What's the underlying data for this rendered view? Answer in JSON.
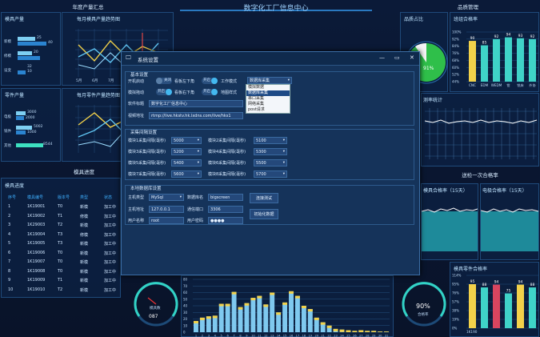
{
  "header": {
    "left_title": "年度产量汇总",
    "center_title": "数字化工厂信息中心",
    "right_title": "品质管理"
  },
  "panels": {
    "annual_output": "模具产量",
    "monthly_mold": "每月模具产量趋势图",
    "part_output": "零件产量",
    "monthly_part": "每月零件产量趋势图",
    "mold_progress": "模具进度",
    "quality_tab": "品质占比",
    "pass_rate": "班组合格率",
    "sample_stats": "测率统计",
    "first_pass": "送检一次合格率",
    "mold_rate": "模具合格率（15天）",
    "elec_rate": "电极合格率（15天）",
    "part_rate": "模具零件合格率"
  },
  "mold_bars": {
    "labels": [
      "新模",
      "修模",
      "设变"
    ],
    "values": [
      "25",
      "40",
      "20",
      "32",
      "10"
    ]
  },
  "part_bars": {
    "labels": [
      "电极",
      "铣件",
      "其他"
    ],
    "values": [
      "3000",
      "2000",
      "5002",
      "1000",
      "8544"
    ]
  },
  "trend_months": [
    "5月",
    "6月",
    "7月",
    "8月",
    "9月"
  ],
  "progress_table": {
    "headers": [
      "序号",
      "模具编号",
      "版本号",
      "类型",
      "状态"
    ],
    "rows": [
      [
        "1",
        "1K19001",
        "T0",
        "新模",
        "加工中"
      ],
      [
        "2",
        "1K19002",
        "T1",
        "修模",
        "加工中"
      ],
      [
        "3",
        "1K29003",
        "T2",
        "新模",
        "加工中"
      ],
      [
        "4",
        "1K19004",
        "T3",
        "修模",
        "加工中"
      ],
      [
        "5",
        "1K19005",
        "T3",
        "新模",
        "加工中"
      ],
      [
        "6",
        "1K19006",
        "T0",
        "新模",
        "加工中"
      ],
      [
        "7",
        "1K19007",
        "T0",
        "新模",
        "加工中"
      ],
      [
        "8",
        "1K19008",
        "T0",
        "新模",
        "加工中"
      ],
      [
        "9",
        "1K19009",
        "T1",
        "新模",
        "加工中"
      ],
      [
        "10",
        "1K19010",
        "T2",
        "新模",
        "加工中"
      ]
    ]
  },
  "pie": {
    "label": "91%"
  },
  "pass_chart": {
    "ticks": [
      "100%",
      "92%",
      "84%",
      "76%",
      "68%",
      "60%",
      "52%",
      "44%"
    ],
    "values": [
      90,
      85,
      92,
      94,
      93,
      92
    ],
    "labels": [
      "CNC",
      "EDM",
      "WEDM",
      "钳",
      "铣床",
      "外协"
    ]
  },
  "part_chart": {
    "ticks": [
      "114%",
      "95%",
      "76%",
      "57%",
      "38%",
      "19%",
      "0%"
    ],
    "values": [
      95,
      88,
      94,
      75,
      94,
      88
    ],
    "labels": [
      "1K190",
      "",
      "",
      "",
      "",
      ""
    ]
  },
  "gauge_left": {
    "label": "模具数",
    "value": "087"
  },
  "gauge_right": {
    "value": "90%",
    "label": "合格率"
  },
  "bottom_chart": {
    "yticks": [
      "80",
      "70",
      "60",
      "50",
      "40",
      "30",
      "20",
      "10",
      "0"
    ],
    "values": [
      17,
      22,
      24,
      25,
      43,
      43,
      61,
      38,
      44,
      52,
      55,
      42,
      60,
      30,
      45,
      62,
      55,
      40,
      35,
      22,
      15,
      10,
      5,
      4,
      3,
      2,
      3,
      2,
      2,
      1,
      1
    ]
  },
  "dialog": {
    "title": "系统设置",
    "basic_group": "基本设置",
    "start_label": "开机启动",
    "start_toggle": "关闭",
    "kanban_label": "看板左下角",
    "kanban_toggle": "开启",
    "work_mode_label": "工作模式",
    "work_mode_value": "数据库采集",
    "auto_label": "模拟拖动",
    "auto_toggle": "开启",
    "right_label": "看板右下角",
    "right_toggle": "开启",
    "map_label": "地图样式",
    "software_label": "软件标题",
    "software_value": "数字化工厂信息中心",
    "video_label": "视频地址",
    "video_value": "rtmp://live.hkstv.hk.lxdns.com/live/hks1",
    "dropdown": [
      "模拟数据",
      "数据库采集",
      "串口采集",
      "网络采集",
      "post请求"
    ],
    "interval_group": "采集间隔设置",
    "intervals": [
      {
        "l1": "模块1采集间隔(毫秒)",
        "v1": "5000",
        "l2": "模块2采集间隔(毫秒)",
        "v2": "5100"
      },
      {
        "l1": "模块3采集间隔(毫秒)",
        "v1": "5200",
        "l2": "模块4采集间隔(毫秒)",
        "v2": "5300"
      },
      {
        "l1": "模块5采集间隔(毫秒)",
        "v1": "5400",
        "l2": "模块6采集间隔(毫秒)",
        "v2": "5500"
      },
      {
        "l1": "模块7采集间隔(毫秒)",
        "v1": "5600",
        "l2": "模块8采集间隔(毫秒)",
        "v2": "5700"
      }
    ],
    "db_group": "本地数据库设置",
    "host_type_label": "主机类型",
    "host_type_value": "MySql",
    "db_name_label": "数据库名",
    "db_name_value": "bigscreen",
    "host_addr_label": "主机地址",
    "host_addr_value": "127.0.0.1",
    "port_label": "通信端口",
    "port_value": "3306",
    "user_label": "用户名称",
    "user_value": "root",
    "pwd_label": "用户密码",
    "pwd_value": "●●●●",
    "test_btn": "连接测试",
    "init_btn": "初始化数据"
  }
}
